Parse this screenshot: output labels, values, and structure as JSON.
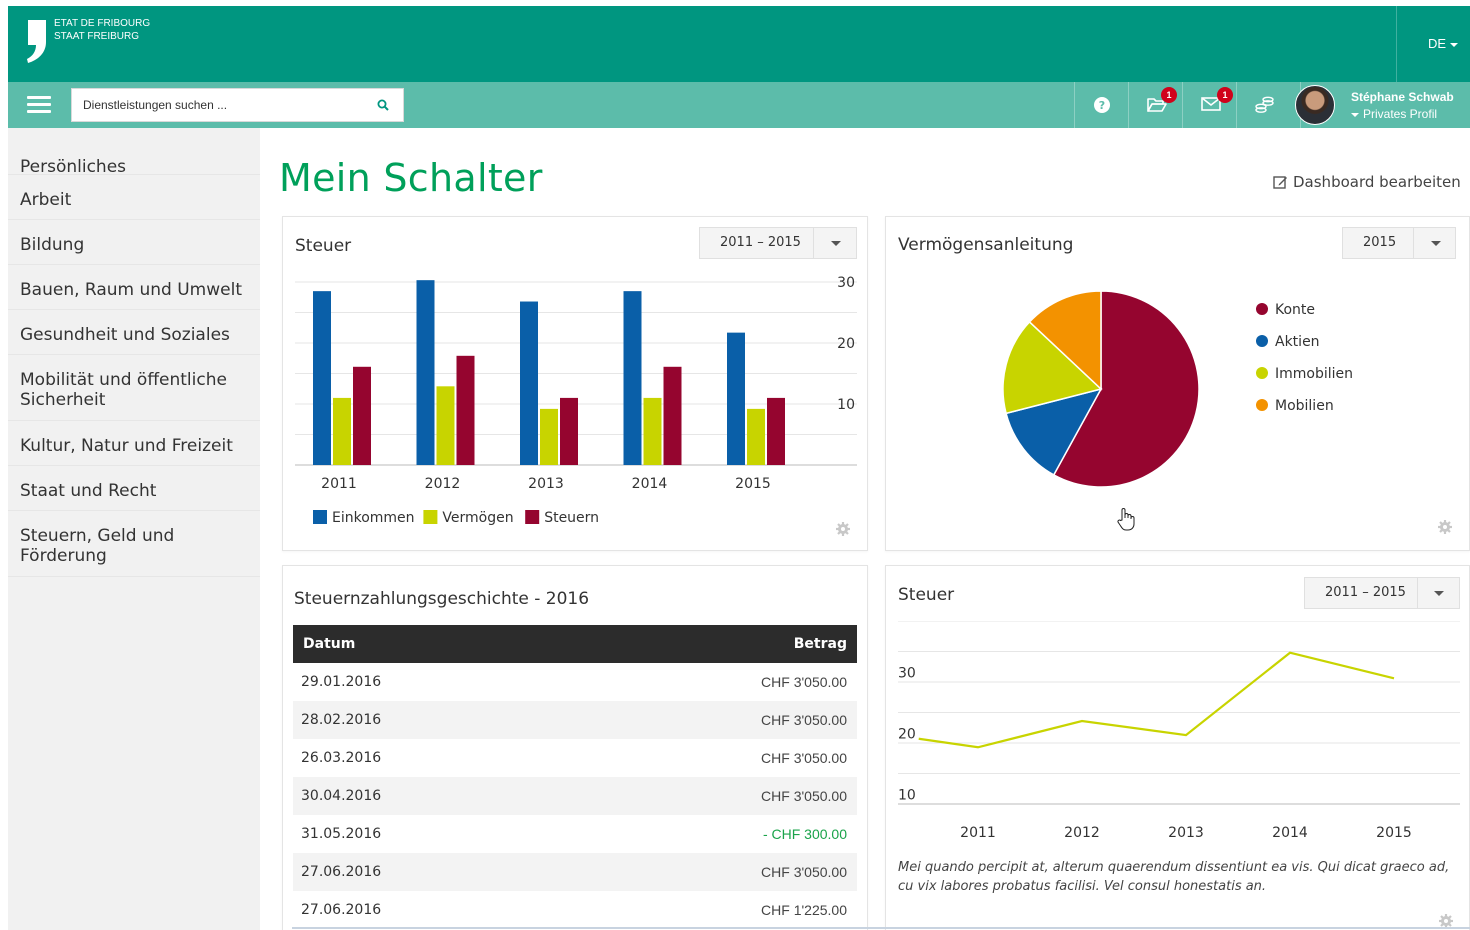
{
  "brand": {
    "line1": "ETAT DE FRIBOURG",
    "line2": "STAAT FREIBURG"
  },
  "header": {
    "language": "DE"
  },
  "toolbar": {
    "search_placeholder": "Dienstleistungen suchen ...",
    "icons": [
      "question-icon",
      "folder-icon",
      "envelope-icon",
      "coins-icon"
    ],
    "folder_badge": "1",
    "mail_badge": "1",
    "user_name": "Stéphane Schwab",
    "user_menu": "Privates Profil"
  },
  "sidebar": {
    "items": [
      "Persönliches",
      "Arbeit",
      "Bildung",
      "Bauen, Raum und Umwelt",
      "Gesundheit und Soziales",
      "Mobilität und öffentliche Sicherheit",
      "Kultur, Natur und Freizeit",
      "Staat und Recht",
      "Steuern, Geld und Förderung"
    ]
  },
  "main": {
    "title": "Mein Schalter",
    "edit_label": "Dashboard bearbeiten"
  },
  "colors": {
    "blue": "#0a5fa8",
    "yellow": "#c8d400",
    "red": "#95052f",
    "orange": "#f39200",
    "green": "#00a05a",
    "teal": "#009680"
  },
  "tax_card": {
    "title": "Steuer",
    "range": "2011 – 2015"
  },
  "wealth_card": {
    "title": "Vermögensanleitung",
    "year": "2015"
  },
  "history_card": {
    "title": "Steuernzahlungsgeschichte - 2016",
    "columns": [
      "Datum",
      "Betrag"
    ],
    "rows": [
      {
        "date": "29.01.2016",
        "amount": "CHF 3'050.00"
      },
      {
        "date": "28.02.2016",
        "amount": "CHF 3'050.00"
      },
      {
        "date": "26.03.2016",
        "amount": "CHF 3'050.00"
      },
      {
        "date": "30.04.2016",
        "amount": "CHF 3'050.00"
      },
      {
        "date": "31.05.2016",
        "amount": "- CHF 300.00"
      },
      {
        "date": "27.06.2016",
        "amount": "CHF 3'050.00"
      },
      {
        "date": "27.06.2016",
        "amount": "CHF 1'225.00"
      }
    ]
  },
  "tax_line_card": {
    "title": "Steuer",
    "range": "2011 – 2015",
    "description": "Mei quando percipit at, alterum quaerendum dissentiunt ea vis. Qui dicat graeco ad, cu vix labores probatus facilisi. Vel consul honestatis an."
  },
  "chart_data": [
    {
      "type": "bar",
      "categories": [
        "2011",
        "2012",
        "2013",
        "2014",
        "2015"
      ],
      "series": [
        {
          "name": "Einkommen",
          "color": "#0a5fa8",
          "values": [
            28.5,
            30.3,
            26.8,
            28.5,
            21.7
          ]
        },
        {
          "name": "Vermögen",
          "color": "#c8d400",
          "values": [
            11,
            12.9,
            9.2,
            11,
            9.2
          ]
        },
        {
          "name": "Steuern",
          "color": "#95052f",
          "values": [
            16.1,
            17.9,
            11,
            16.1,
            11
          ]
        }
      ],
      "yticks": [
        10,
        20,
        30
      ],
      "ylim": [
        0,
        30
      ],
      "grid": true,
      "legend": "bottom-left"
    },
    {
      "type": "pie",
      "labels": [
        "Konte",
        "Aktien",
        "Immobilien",
        "Mobilien"
      ],
      "values": [
        58,
        13,
        16,
        13
      ],
      "colors": [
        "#95052f",
        "#0a5fa8",
        "#c8d400",
        "#f39200"
      ],
      "legend": "right"
    },
    {
      "type": "line",
      "x": [
        2010.43,
        2011,
        2012,
        2013,
        2014,
        2015
      ],
      "series": [
        {
          "color": "#c8d400",
          "values": [
            15.7,
            14.3,
            18.6,
            16.3,
            29.8,
            25.6
          ]
        }
      ],
      "xticks": [
        "2011",
        "2012",
        "2013",
        "2014",
        "2015"
      ],
      "yticks": [
        10,
        20,
        30
      ],
      "ylim": [
        5,
        35
      ],
      "grid": true
    }
  ]
}
